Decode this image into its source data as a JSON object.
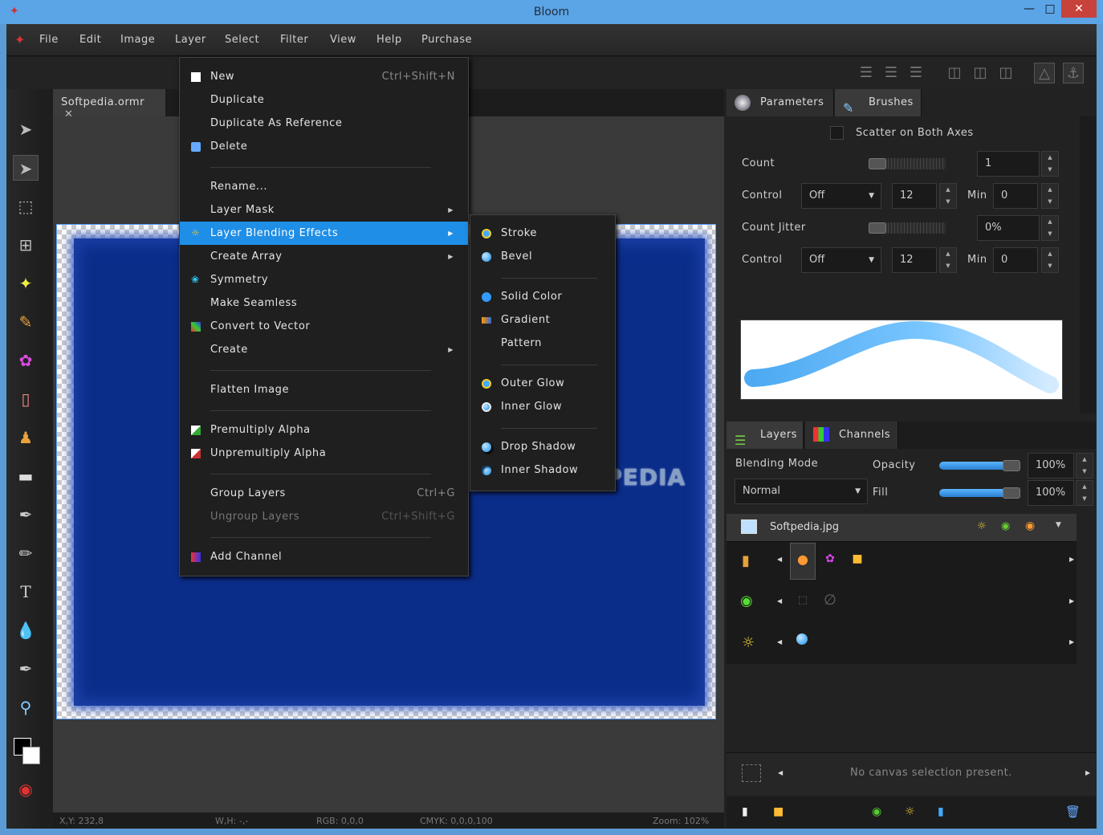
{
  "window": {
    "title": "Bloom",
    "minimize": "—",
    "maximize": "□",
    "close": "✕"
  },
  "menubar": [
    "File",
    "Edit",
    "Image",
    "Layer",
    "Select",
    "Filter",
    "View",
    "Help",
    "Purchase"
  ],
  "document": {
    "tab_label": "Softpedia.ormr",
    "tab_close": "✕"
  },
  "layer_menu": {
    "items": [
      {
        "label": "New",
        "shortcut": "Ctrl+Shift+N"
      },
      {
        "label": "Duplicate"
      },
      {
        "label": "Duplicate As Reference"
      },
      {
        "label": "Delete"
      },
      {
        "label": "Rename..."
      },
      {
        "label": "Layer Mask"
      },
      {
        "label": "Layer Blending Effects"
      },
      {
        "label": "Create Array"
      },
      {
        "label": "Symmetry"
      },
      {
        "label": "Make Seamless"
      },
      {
        "label": "Convert to Vector"
      },
      {
        "label": "Create"
      },
      {
        "label": "Flatten Image"
      },
      {
        "label": "Premultiply Alpha"
      },
      {
        "label": "Unpremultiply Alpha"
      },
      {
        "label": "Group Layers",
        "shortcut": "Ctrl+G"
      },
      {
        "label": "Ungroup Layers",
        "shortcut": "Ctrl+Shift+G"
      },
      {
        "label": "Add Channel"
      }
    ]
  },
  "blending_submenu": [
    "Stroke",
    "Bevel",
    "Solid Color",
    "Gradient",
    "Pattern",
    "Outer Glow",
    "Inner Glow",
    "Drop Shadow",
    "Inner Shadow"
  ],
  "watermark": "SOFTPEDIA",
  "parameters_panel": {
    "tabs": [
      "Parameters",
      "Brushes"
    ],
    "scatter_label": "Scatter on Both Axes",
    "count_label": "Count",
    "count_value": "1",
    "control_label": "Control",
    "control_value": "Off",
    "control_num": "12",
    "min_label": "Min",
    "min_value": "0",
    "count_jitter_label": "Count Jitter",
    "count_jitter_value": "0%",
    "control2_label": "Control",
    "control2_value": "Off",
    "control2_num": "12",
    "min2_label": "Min",
    "min2_value": "0"
  },
  "layers_panel": {
    "tabs": [
      "Layers",
      "Channels"
    ],
    "blending_mode_label": "Blending Mode",
    "blending_mode_value": "Normal",
    "opacity_label": "Opacity",
    "opacity_value": "100%",
    "fill_label": "Fill",
    "fill_value": "100%",
    "layer_name": "Softpedia.jpg",
    "selection_text": "No canvas selection present."
  },
  "statusbar": {
    "xy": "X,Y: 232,8",
    "wh": "W,H: -,-",
    "rgb": "RGB: 0,0,0",
    "cmyk": "CMYK: 0,0,0,100",
    "zoom": "Zoom: 102%"
  },
  "colors": {
    "accent": "#1f8ee6",
    "canvas_fill": "#0b2d8a",
    "titlebar": "#5ba4e6"
  }
}
